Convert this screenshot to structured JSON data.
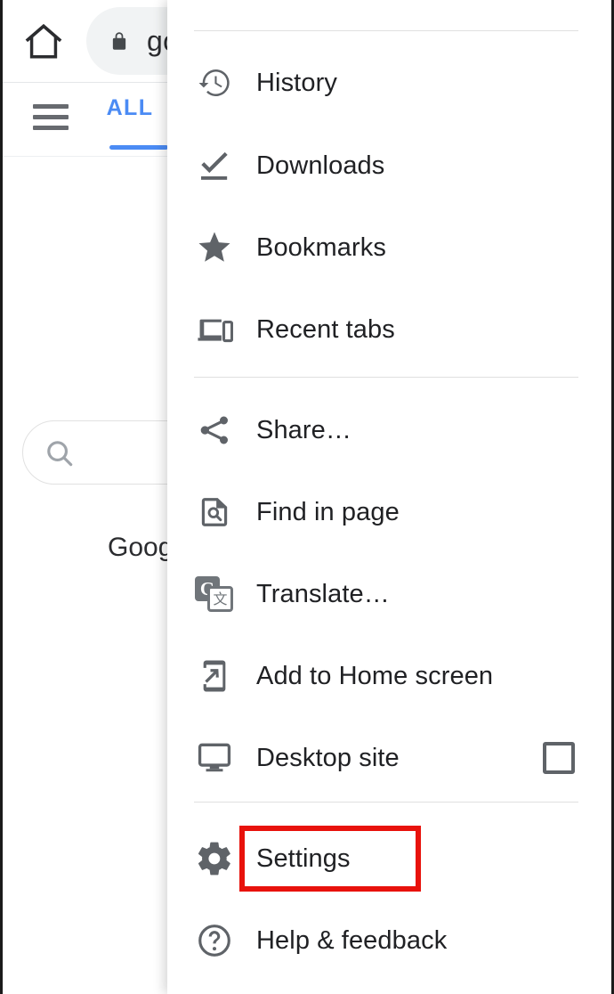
{
  "browser": {
    "home_icon": "home-icon",
    "lock_icon": "lock-icon",
    "url_text": "go",
    "hamburger_icon": "hamburger-icon",
    "tab_label": "ALL",
    "accent_color": "#4285f4",
    "search_icon": "search-icon",
    "search_placeholder": "",
    "google_word": "Googl"
  },
  "menu": {
    "highlight_color": "#e8120c",
    "highlighted_item": "Settings",
    "items": [
      {
        "id": "history",
        "label": "History",
        "icon": "history-icon",
        "type": "item"
      },
      {
        "id": "downloads",
        "label": "Downloads",
        "icon": "download-check-icon",
        "type": "item"
      },
      {
        "id": "bookmarks",
        "label": "Bookmarks",
        "icon": "star-icon",
        "type": "item"
      },
      {
        "id": "recent-tabs",
        "label": "Recent tabs",
        "icon": "devices-icon",
        "type": "item"
      },
      {
        "id": "share",
        "label": "Share…",
        "icon": "share-icon",
        "type": "item"
      },
      {
        "id": "find-in-page",
        "label": "Find in page",
        "icon": "find-in-page-icon",
        "type": "item"
      },
      {
        "id": "translate",
        "label": "Translate…",
        "icon": "translate-icon",
        "type": "item"
      },
      {
        "id": "add-to-home",
        "label": "Add to Home screen",
        "icon": "add-to-home-screen-icon",
        "type": "item"
      },
      {
        "id": "desktop-site",
        "label": "Desktop site",
        "icon": "desktop-icon",
        "type": "checkbox",
        "checked": false
      },
      {
        "id": "settings",
        "label": "Settings",
        "icon": "gear-icon",
        "type": "item"
      },
      {
        "id": "help",
        "label": "Help & feedback",
        "icon": "help-circle-icon",
        "type": "item"
      }
    ]
  }
}
